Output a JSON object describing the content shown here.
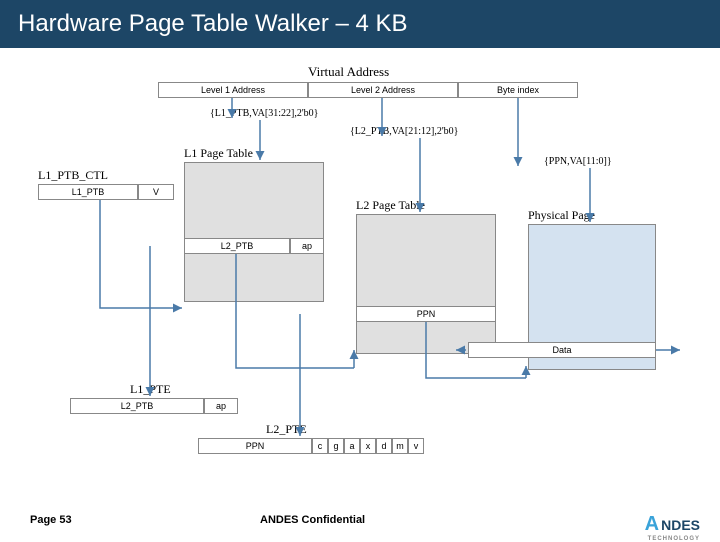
{
  "title": "Hardware Page Table Walker – 4 KB",
  "va_label": "Virtual Address",
  "va_fields": {
    "l1": "Level 1 Address",
    "l2": "Level 2 Address",
    "byte": "Byte index"
  },
  "offsets": {
    "l1": "{L1_PTB,VA[31:22],2'b0}",
    "l2": "{L2_PTB,VA[21:12],2'b0}",
    "phys": "{PPN,VA[11:0]}"
  },
  "l1_table": "L1 Page Table",
  "l2_table": "L2 Page Table",
  "phys_page": "Physical Page",
  "l1_ptb_ctl": "L1_PTB_CTL",
  "l1_ptb_fields": {
    "ptb": "L1_PTB",
    "v": "V"
  },
  "row_l2ptb": {
    "ptb": "L2_PTB",
    "ap": "ap"
  },
  "row_ppn": {
    "ppn": "PPN"
  },
  "row_data": {
    "data": "Data"
  },
  "l1_pte": "L1_PTE",
  "l1_pte_fields": {
    "ptb": "L2_PTB",
    "ap": "ap"
  },
  "l2_pte": "L2_PTE",
  "l2_pte_fields": {
    "ppn": "PPN",
    "c": "c",
    "g": "g",
    "a": "a",
    "x": "x",
    "d": "d",
    "m": "m",
    "v": "v"
  },
  "footer": {
    "page": "Page 53",
    "conf": "ANDES Confidential",
    "logo": "NDES",
    "logo_sub": "TECHNOLOGY"
  }
}
